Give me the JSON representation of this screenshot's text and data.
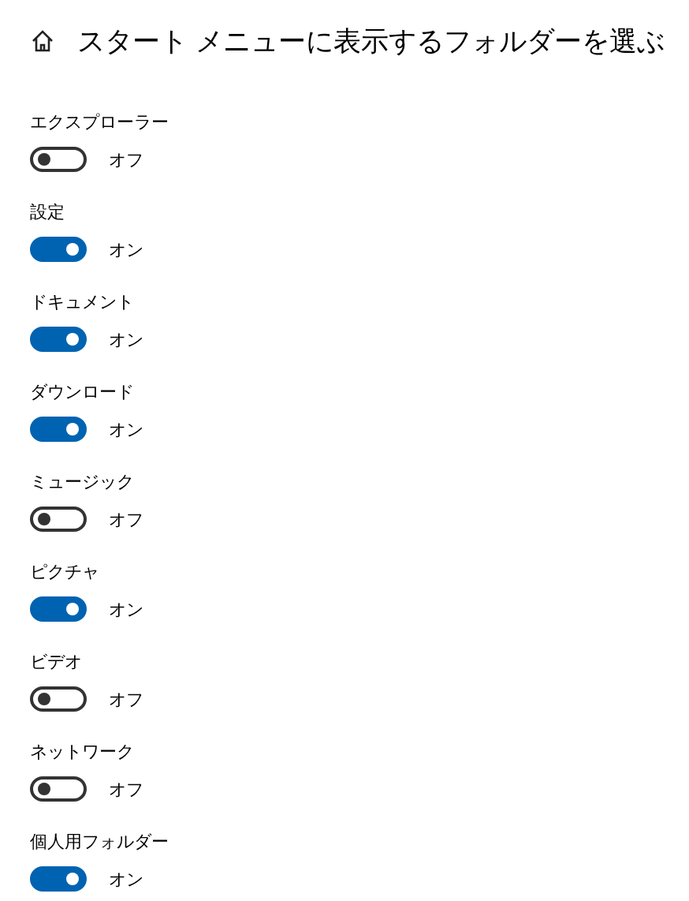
{
  "header": {
    "title": "スタート メニューに表示するフォルダーを選ぶ"
  },
  "folders": [
    {
      "label": "エクスプローラー",
      "on": false,
      "state_text": "オフ"
    },
    {
      "label": "設定",
      "on": true,
      "state_text": "オン"
    },
    {
      "label": "ドキュメント",
      "on": true,
      "state_text": "オン"
    },
    {
      "label": "ダウンロード",
      "on": true,
      "state_text": "オン"
    },
    {
      "label": "ミュージック",
      "on": false,
      "state_text": "オフ"
    },
    {
      "label": "ピクチャ",
      "on": true,
      "state_text": "オン"
    },
    {
      "label": "ビデオ",
      "on": false,
      "state_text": "オフ"
    },
    {
      "label": "ネットワーク",
      "on": false,
      "state_text": "オフ"
    },
    {
      "label": "個人用フォルダー",
      "on": true,
      "state_text": "オン"
    }
  ]
}
